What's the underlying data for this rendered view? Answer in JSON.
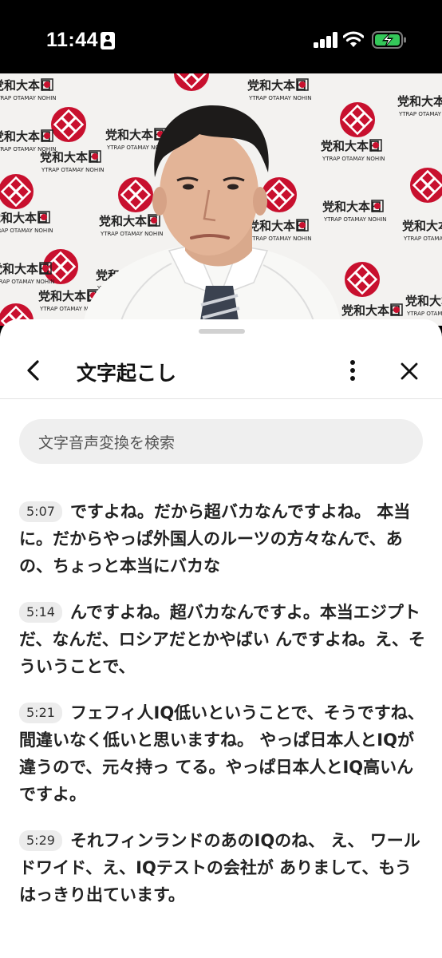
{
  "status_bar": {
    "time": "11:44",
    "icons": [
      "id-card-icon",
      "cellular-signal-icon",
      "wifi-icon",
      "battery-charging-icon"
    ]
  },
  "video": {
    "backdrop_logo_text": "日本大和党",
    "backdrop_logo_subtext": "NIHON YAMATO PARTY",
    "accent_color": "#c8102e"
  },
  "sheet": {
    "title": "文字起こし",
    "icons": {
      "back": "chevron-left-icon",
      "more": "more-vertical-icon",
      "close": "close-icon"
    },
    "search": {
      "placeholder": "文字音声変換を検索"
    },
    "segments": [
      {
        "time": "5:07",
        "text": "ですよね。だから超バカなんですよね。 本当に。だからやっぱ外国人のルーツの方々なんで、あの、ちょっと本当にバカな"
      },
      {
        "time": "5:14",
        "text": "んですよね。超バカなんですよ。本当エジプトだ、なんだ、ロシアだとかやばい んですよね。え、そういうことで、"
      },
      {
        "time": "5:21",
        "text": "フェフィ人IQ低いということで、そうですね、間違いなく低いと思いますね。 やっぱ日本人とIQが違うので、元々持っ てる。やっぱ日本人とIQ高いんですよ。"
      },
      {
        "time": "5:29",
        "text": "それフィンランドのあのIQのね、 え、 ワールドワイド、え、IQテストの会社が ありまして、もうはっきり出ています。"
      }
    ]
  }
}
